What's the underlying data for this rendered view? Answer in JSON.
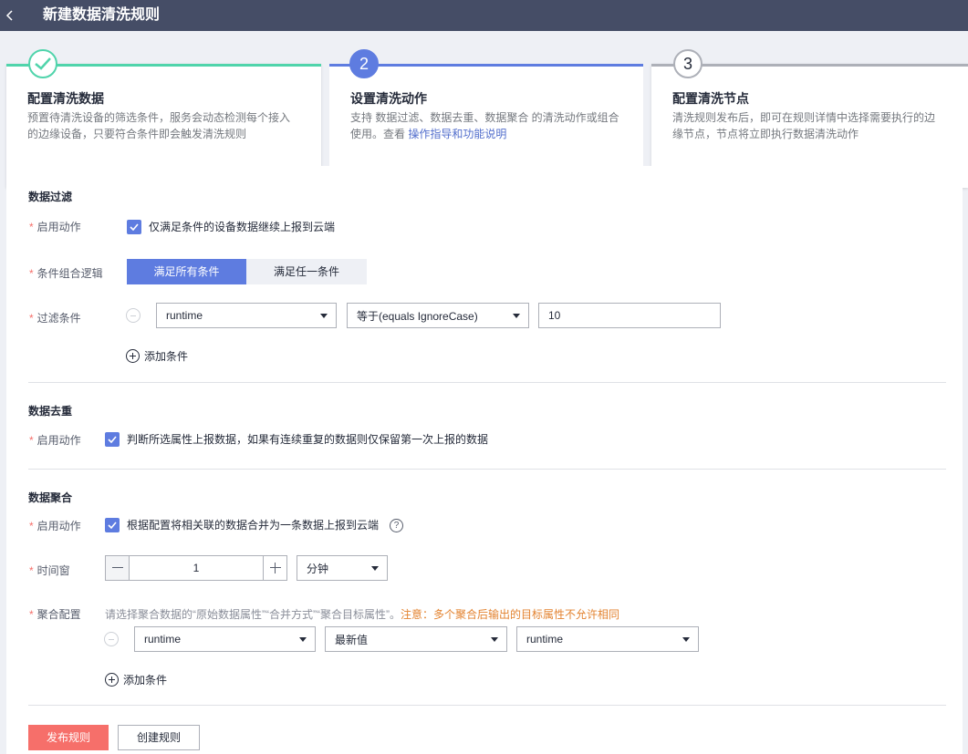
{
  "header": {
    "title": "新建数据清洗规则",
    "back_icon": "chevron-left-icon"
  },
  "steps": [
    {
      "number": "",
      "icon": "check-icon",
      "title": "配置清洗数据",
      "desc_line1": "预置待清洗设备的筛选条件，服务会动态检测每个接入",
      "desc_line2": "的边缘设备，只要符合条件即会触发清洗规则"
    },
    {
      "number": "2",
      "title": "设置清洗动作",
      "desc_line1": "支持 数据过滤、数据去重、数据聚合 的清洗动作或组合",
      "desc_line2_prefix": "使用。查看 ",
      "desc_link": "操作指导和功能说明"
    },
    {
      "number": "3",
      "title": "配置清洗节点",
      "desc_line1": "清洗规则发布后，即可在规则详情中选择需要执行的边",
      "desc_line2": "缘节点，节点将立即执行数据清洗动作"
    }
  ],
  "filter": {
    "section_title": "数据过滤",
    "enable_label": "启用动作",
    "enable_checkbox": "仅满足条件的设备数据继续上报到云端",
    "logic_label": "条件组合逻辑",
    "logic_options": [
      "满足所有条件",
      "满足任一条件"
    ],
    "condition_label": "过滤条件",
    "attribute": "runtime",
    "operator": "等于(equals IgnoreCase)",
    "value": "10",
    "add_condition": "添加条件"
  },
  "dedup": {
    "section_title": "数据去重",
    "enable_label": "启用动作",
    "enable_checkbox": "判断所选属性上报数据，如果有连续重复的数据则仅保留第一次上报的数据"
  },
  "aggregate": {
    "section_title": "数据聚合",
    "enable_label": "启用动作",
    "enable_checkbox": "根据配置将相关联的数据合并为一条数据上报到云端",
    "help_icon": "?",
    "window_label": "时间窗",
    "window_value": "1",
    "window_unit": "分钟",
    "config_label": "聚合配置",
    "config_hint": "请选择聚合数据的“原始数据属性”“合并方式”“聚合目标属性”。",
    "config_warning": "注意：多个聚合后输出的目标属性不允许相同",
    "source_attr": "runtime",
    "merge_method": "最新值",
    "target_attr": "runtime",
    "add_condition": "添加条件"
  },
  "footer": {
    "publish": "发布规则",
    "create": "创建规则"
  },
  "colors": {
    "header_bg": "#454d66",
    "primary": "#5e7ce0",
    "done": "#50d4ab",
    "danger": "#f66f6a",
    "warning": "#e38330"
  }
}
